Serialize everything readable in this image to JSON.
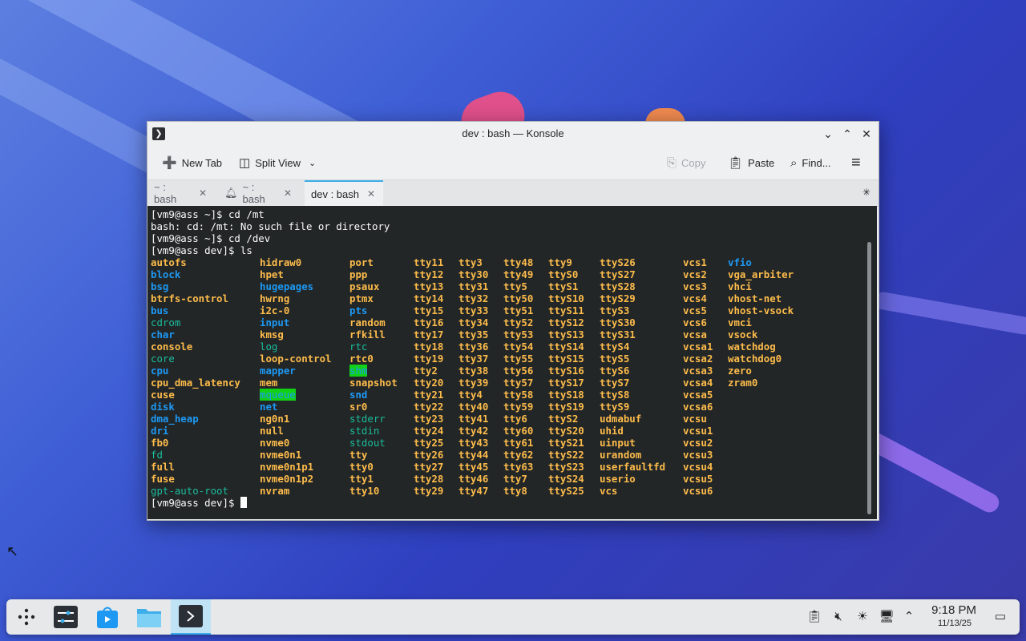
{
  "colors": {
    "dir": "#1d99f3",
    "file": "#fdbc4b",
    "link": "#1abc9c",
    "sticky_bg": "#11d116",
    "sticky_fg": "#1d99f3",
    "fg": "#fcfcfc"
  },
  "window": {
    "title": "dev : bash — Konsole",
    "app_icon": "konsole-icon",
    "controls": [
      "minimize",
      "maximize",
      "close"
    ]
  },
  "toolbar": {
    "new_tab": "New Tab",
    "split_view": "Split View",
    "copy": "Copy",
    "paste": "Paste",
    "find": "Find..."
  },
  "tabs": [
    {
      "label": "~ : bash",
      "active": false,
      "bell": false
    },
    {
      "label": "~ : bash",
      "active": false,
      "bell": true
    },
    {
      "label": "dev : bash",
      "active": true,
      "bell": false
    }
  ],
  "terminal": {
    "lines": [
      "[vm9@ass ~]$ cd /mt",
      "bash: cd: /mt: No such file or directory",
      "[vm9@ass ~]$ cd /dev",
      "[vm9@ass dev]$ ls"
    ],
    "prompt": "[vm9@ass dev]$ ",
    "columns": [
      [
        [
          "autofs",
          "f"
        ],
        [
          "block",
          "d"
        ],
        [
          "bsg",
          "d"
        ],
        [
          "btrfs-control",
          "f"
        ],
        [
          "bus",
          "d"
        ],
        [
          "cdrom",
          "l"
        ],
        [
          "char",
          "d"
        ],
        [
          "console",
          "f"
        ],
        [
          "core",
          "l"
        ],
        [
          "cpu",
          "d"
        ],
        [
          "cpu_dma_latency",
          "f"
        ],
        [
          "cuse",
          "f"
        ],
        [
          "disk",
          "d"
        ],
        [
          "dma_heap",
          "d"
        ],
        [
          "dri",
          "d"
        ],
        [
          "fb0",
          "f"
        ],
        [
          "fd",
          "l"
        ],
        [
          "full",
          "f"
        ],
        [
          "fuse",
          "f"
        ],
        [
          "gpt-auto-root",
          "l"
        ]
      ],
      [
        [
          "hidraw0",
          "f"
        ],
        [
          "hpet",
          "f"
        ],
        [
          "hugepages",
          "d"
        ],
        [
          "hwrng",
          "f"
        ],
        [
          "i2c-0",
          "f"
        ],
        [
          "input",
          "d"
        ],
        [
          "kmsg",
          "f"
        ],
        [
          "log",
          "l"
        ],
        [
          "loop-control",
          "f"
        ],
        [
          "mapper",
          "d"
        ],
        [
          "mem",
          "f"
        ],
        [
          "mqueue",
          "s"
        ],
        [
          "net",
          "d"
        ],
        [
          "ng0n1",
          "f"
        ],
        [
          "null",
          "f"
        ],
        [
          "nvme0",
          "f"
        ],
        [
          "nvme0n1",
          "f"
        ],
        [
          "nvme0n1p1",
          "f"
        ],
        [
          "nvme0n1p2",
          "f"
        ],
        [
          "nvram",
          "f"
        ]
      ],
      [
        [
          "port",
          "f"
        ],
        [
          "ppp",
          "f"
        ],
        [
          "psaux",
          "f"
        ],
        [
          "ptmx",
          "f"
        ],
        [
          "pts",
          "d"
        ],
        [
          "random",
          "f"
        ],
        [
          "rfkill",
          "f"
        ],
        [
          "rtc",
          "l"
        ],
        [
          "rtc0",
          "f"
        ],
        [
          "shm",
          "s"
        ],
        [
          "snapshot",
          "f"
        ],
        [
          "snd",
          "d"
        ],
        [
          "sr0",
          "f"
        ],
        [
          "stderr",
          "l"
        ],
        [
          "stdin",
          "l"
        ],
        [
          "stdout",
          "l"
        ],
        [
          "tty",
          "f"
        ],
        [
          "tty0",
          "f"
        ],
        [
          "tty1",
          "f"
        ],
        [
          "tty10",
          "f"
        ]
      ],
      [
        [
          "tty11",
          "f"
        ],
        [
          "tty12",
          "f"
        ],
        [
          "tty13",
          "f"
        ],
        [
          "tty14",
          "f"
        ],
        [
          "tty15",
          "f"
        ],
        [
          "tty16",
          "f"
        ],
        [
          "tty17",
          "f"
        ],
        [
          "tty18",
          "f"
        ],
        [
          "tty19",
          "f"
        ],
        [
          "tty2",
          "f"
        ],
        [
          "tty20",
          "f"
        ],
        [
          "tty21",
          "f"
        ],
        [
          "tty22",
          "f"
        ],
        [
          "tty23",
          "f"
        ],
        [
          "tty24",
          "f"
        ],
        [
          "tty25",
          "f"
        ],
        [
          "tty26",
          "f"
        ],
        [
          "tty27",
          "f"
        ],
        [
          "tty28",
          "f"
        ],
        [
          "tty29",
          "f"
        ]
      ],
      [
        [
          "tty3",
          "f"
        ],
        [
          "tty30",
          "f"
        ],
        [
          "tty31",
          "f"
        ],
        [
          "tty32",
          "f"
        ],
        [
          "tty33",
          "f"
        ],
        [
          "tty34",
          "f"
        ],
        [
          "tty35",
          "f"
        ],
        [
          "tty36",
          "f"
        ],
        [
          "tty37",
          "f"
        ],
        [
          "tty38",
          "f"
        ],
        [
          "tty39",
          "f"
        ],
        [
          "tty4",
          "f"
        ],
        [
          "tty40",
          "f"
        ],
        [
          "tty41",
          "f"
        ],
        [
          "tty42",
          "f"
        ],
        [
          "tty43",
          "f"
        ],
        [
          "tty44",
          "f"
        ],
        [
          "tty45",
          "f"
        ],
        [
          "tty46",
          "f"
        ],
        [
          "tty47",
          "f"
        ]
      ],
      [
        [
          "tty48",
          "f"
        ],
        [
          "tty49",
          "f"
        ],
        [
          "tty5",
          "f"
        ],
        [
          "tty50",
          "f"
        ],
        [
          "tty51",
          "f"
        ],
        [
          "tty52",
          "f"
        ],
        [
          "tty53",
          "f"
        ],
        [
          "tty54",
          "f"
        ],
        [
          "tty55",
          "f"
        ],
        [
          "tty56",
          "f"
        ],
        [
          "tty57",
          "f"
        ],
        [
          "tty58",
          "f"
        ],
        [
          "tty59",
          "f"
        ],
        [
          "tty6",
          "f"
        ],
        [
          "tty60",
          "f"
        ],
        [
          "tty61",
          "f"
        ],
        [
          "tty62",
          "f"
        ],
        [
          "tty63",
          "f"
        ],
        [
          "tty7",
          "f"
        ],
        [
          "tty8",
          "f"
        ]
      ],
      [
        [
          "tty9",
          "f"
        ],
        [
          "ttyS0",
          "f"
        ],
        [
          "ttyS1",
          "f"
        ],
        [
          "ttyS10",
          "f"
        ],
        [
          "ttyS11",
          "f"
        ],
        [
          "ttyS12",
          "f"
        ],
        [
          "ttyS13",
          "f"
        ],
        [
          "ttyS14",
          "f"
        ],
        [
          "ttyS15",
          "f"
        ],
        [
          "ttyS16",
          "f"
        ],
        [
          "ttyS17",
          "f"
        ],
        [
          "ttyS18",
          "f"
        ],
        [
          "ttyS19",
          "f"
        ],
        [
          "ttyS2",
          "f"
        ],
        [
          "ttyS20",
          "f"
        ],
        [
          "ttyS21",
          "f"
        ],
        [
          "ttyS22",
          "f"
        ],
        [
          "ttyS23",
          "f"
        ],
        [
          "ttyS24",
          "f"
        ],
        [
          "ttyS25",
          "f"
        ]
      ],
      [
        [
          "ttyS26",
          "f"
        ],
        [
          "ttyS27",
          "f"
        ],
        [
          "ttyS28",
          "f"
        ],
        [
          "ttyS29",
          "f"
        ],
        [
          "ttyS3",
          "f"
        ],
        [
          "ttyS30",
          "f"
        ],
        [
          "ttyS31",
          "f"
        ],
        [
          "ttyS4",
          "f"
        ],
        [
          "ttyS5",
          "f"
        ],
        [
          "ttyS6",
          "f"
        ],
        [
          "ttyS7",
          "f"
        ],
        [
          "ttyS8",
          "f"
        ],
        [
          "ttyS9",
          "f"
        ],
        [
          "udmabuf",
          "f"
        ],
        [
          "uhid",
          "f"
        ],
        [
          "uinput",
          "f"
        ],
        [
          "urandom",
          "f"
        ],
        [
          "userfaultfd",
          "f"
        ],
        [
          "userio",
          "f"
        ],
        [
          "vcs",
          "f"
        ]
      ],
      [
        [
          "vcs1",
          "f"
        ],
        [
          "vcs2",
          "f"
        ],
        [
          "vcs3",
          "f"
        ],
        [
          "vcs4",
          "f"
        ],
        [
          "vcs5",
          "f"
        ],
        [
          "vcs6",
          "f"
        ],
        [
          "vcsa",
          "f"
        ],
        [
          "vcsa1",
          "f"
        ],
        [
          "vcsa2",
          "f"
        ],
        [
          "vcsa3",
          "f"
        ],
        [
          "vcsa4",
          "f"
        ],
        [
          "vcsa5",
          "f"
        ],
        [
          "vcsa6",
          "f"
        ],
        [
          "vcsu",
          "f"
        ],
        [
          "vcsu1",
          "f"
        ],
        [
          "vcsu2",
          "f"
        ],
        [
          "vcsu3",
          "f"
        ],
        [
          "vcsu4",
          "f"
        ],
        [
          "vcsu5",
          "f"
        ],
        [
          "vcsu6",
          "f"
        ]
      ],
      [
        [
          "vfio",
          "d"
        ],
        [
          "vga_arbiter",
          "f"
        ],
        [
          "vhci",
          "f"
        ],
        [
          "vhost-net",
          "f"
        ],
        [
          "vhost-vsock",
          "f"
        ],
        [
          "vmci",
          "f"
        ],
        [
          "vsock",
          "f"
        ],
        [
          "watchdog",
          "f"
        ],
        [
          "watchdog0",
          "f"
        ],
        [
          "zero",
          "f"
        ],
        [
          "zram0",
          "f"
        ]
      ]
    ]
  },
  "taskbar": {
    "launchers": [
      "app-launcher-icon",
      "system-settings-icon",
      "discover-icon",
      "file-manager-icon",
      "konsole-icon"
    ],
    "tray": [
      "clipboard-icon",
      "volume-muted-icon",
      "brightness-icon",
      "network-icon",
      "expand-tray-icon"
    ],
    "time": "9:18 PM",
    "date": "11/13/25",
    "show_desktop": "show-desktop-icon"
  }
}
